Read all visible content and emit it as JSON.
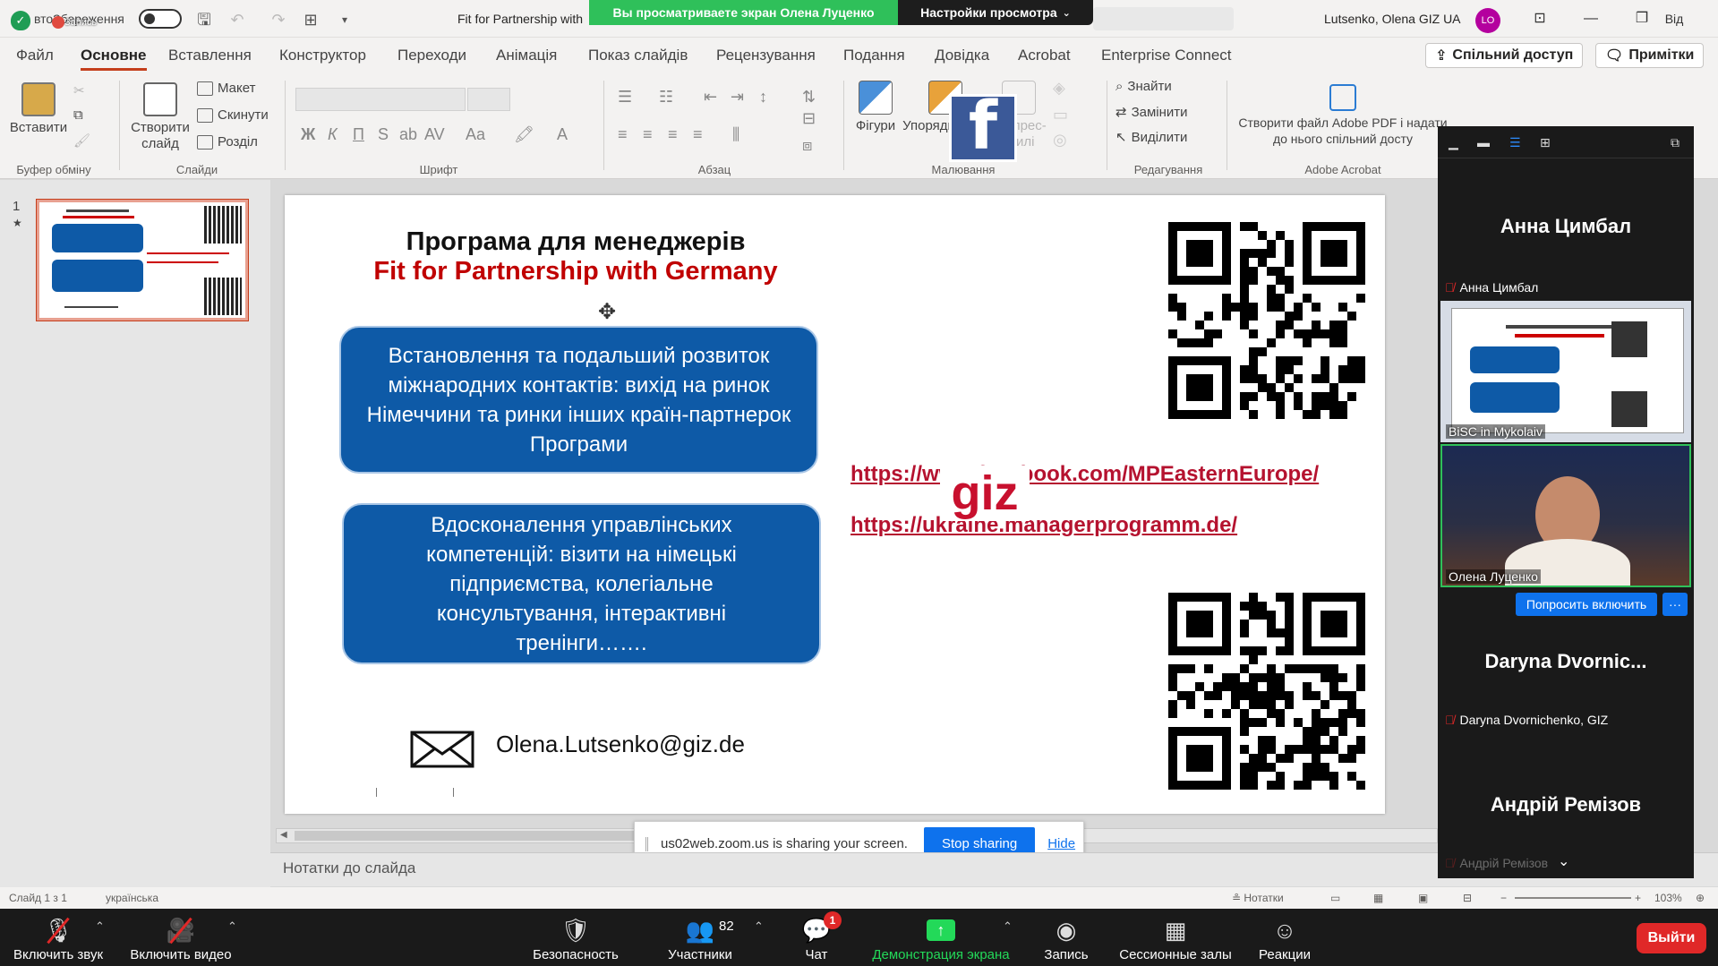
{
  "titlebar": {
    "autosave_label": "втоЗбереження",
    "recording_label": "Запись",
    "doc_title": "Fit for Partnership with",
    "share_banner": "Вы просматриваете экран Олена Луценко",
    "view_options": "Настройки просмотра",
    "user_name": "Lutsenko, Olena GIZ UA",
    "avatar_initials": "LO",
    "exit_label": "Вiд"
  },
  "tabs": [
    {
      "label": "Файл"
    },
    {
      "label": "Основне"
    },
    {
      "label": "Вставлення"
    },
    {
      "label": "Конструктор"
    },
    {
      "label": "Переходи"
    },
    {
      "label": "Анімація"
    },
    {
      "label": "Показ слайдів"
    },
    {
      "label": "Рецензування"
    },
    {
      "label": "Подання"
    },
    {
      "label": "Довідка"
    },
    {
      "label": "Acrobat"
    },
    {
      "label": "Enterprise Connect"
    }
  ],
  "share_button": "Спільний доступ",
  "comments_button": "Примітки",
  "ribbon": {
    "paste": "Вставити",
    "new_slide": "Створити слайд",
    "layout": "Макет",
    "reset": "Скинути",
    "section": "Розділ",
    "shapes": "Фігури",
    "arrange": "Упорядкувати",
    "quick_styles": "Експрес-стилі",
    "find": "Знайти",
    "replace": "Замінити",
    "select": "Виділити",
    "adobe_create": "Створити файл Adobe PDF і надати до нього спільний досту",
    "groups": {
      "clipboard": "Буфер обміну",
      "slides": "Слайди",
      "font": "Шрифт",
      "paragraph": "Абзац",
      "drawing": "Малювання",
      "editing": "Редагування",
      "adobe": "Adobe Acrobat"
    }
  },
  "thumbnail": {
    "number": "1",
    "star": "★"
  },
  "slide": {
    "title_line1": "Програма для менеджерів",
    "title_line2": "Fit for Partnership with Germany",
    "box1": "Встановлення та подальший розвиток міжнародних контактів: вихід на ринок Німеччини та ринки інших країн-партнерок Програми",
    "box2": "Вдосконалення управлінських компетенцій: візити на німецькі підприємства, колегіальне консультування, інтерактивні тренінги…….",
    "link1": "https://www.facebook.com/MPEasternEurope/",
    "link2": "https://ukraine.managerprogramm.de/",
    "email": "Olena.Lutsenko@giz.de",
    "fb_letter": "f",
    "giz_logo": "giz"
  },
  "toast": {
    "message": "us02web.zoom.us is sharing your screen.",
    "stop": "Stop sharing",
    "hide": "Hide"
  },
  "notes_label": "Нотатки до слайда",
  "statusbar": {
    "slide_info": "Слайд 1 з 1",
    "language": "українська",
    "notes": "Нотатки",
    "zoom": "103%"
  },
  "zoom_toolbar": {
    "unmute": "Включить звук",
    "start_video": "Включить видео",
    "security": "Безопасность",
    "participants": "Участники",
    "participants_count": "82",
    "chat": "Чат",
    "chat_badge": "1",
    "share_screen": "Демонстрация экрана",
    "record": "Запись",
    "breakout": "Сессионные залы",
    "reactions": "Реакции",
    "leave": "Выйти"
  },
  "participants": {
    "p1_big": "Анна Цимбал",
    "p1_caption": "Анна Цимбал",
    "p2_caption": "BiSC in Mykolaiv",
    "p3_caption": "Олена Луценко",
    "ask_unmute": "Попросить включить",
    "more": "···",
    "p4_big": "Daryna  Dvornic...",
    "p4_caption": "Daryna Dvornichenko, GIZ",
    "p5_big": "Андрій Ремізов",
    "p5_caption": "Андрій Ремізов"
  }
}
